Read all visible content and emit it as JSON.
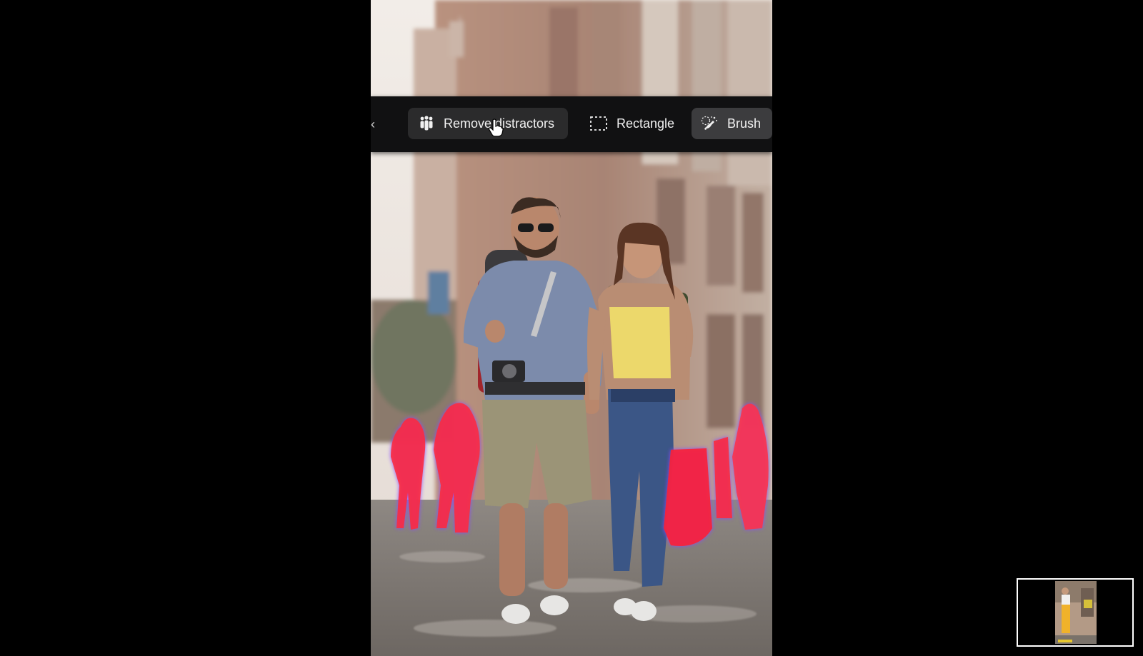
{
  "toolbar": {
    "back_glyph": "‹",
    "remove_distractors_label": "Remove distractors",
    "remove_distractors_icon": "people-group-icon",
    "rectangle_label": "Rectangle",
    "rectangle_icon": "dashed-rectangle-icon",
    "brush_label": "Brush",
    "brush_icon": "brush-sparkle-icon",
    "active_tool": "Brush"
  },
  "canvas": {
    "image_subject": "photo",
    "mask_color": "#ff2a3a",
    "mask_glow_color": "#8a46ff"
  },
  "cursor": {
    "icon": "hand-pointer-icon"
  },
  "thumbnail": {
    "icon": "photo-thumbnail"
  },
  "colors": {
    "toolbar_bg": "#111112",
    "button_bg": "#2b2b2c",
    "active_button_bg": "#3c3c3e",
    "text": "#f1f1f1"
  }
}
